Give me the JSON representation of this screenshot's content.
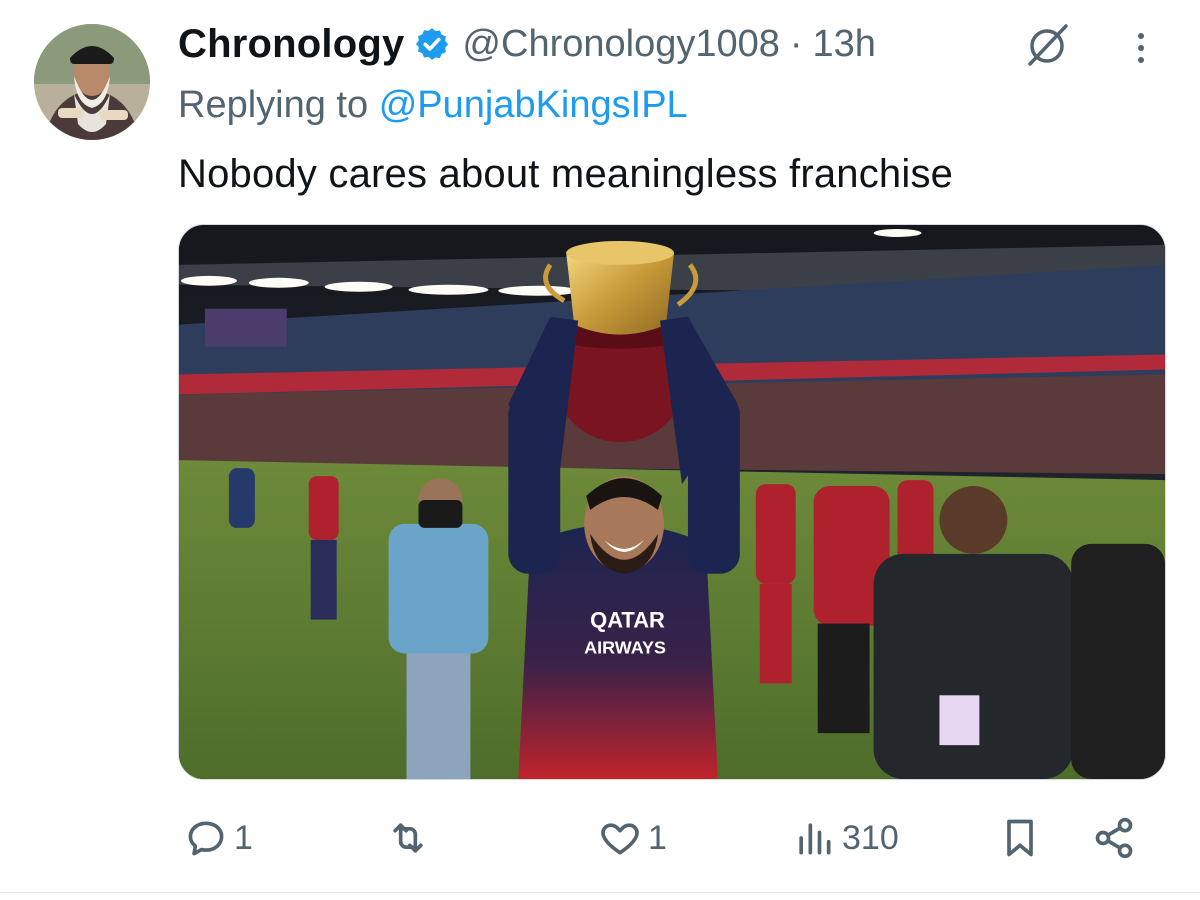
{
  "tweet": {
    "author": {
      "display_name": "Chronology",
      "handle": "@Chronology1008",
      "verified": true,
      "avatar_icon": "user-avatar"
    },
    "separator": "·",
    "time": "13h",
    "reply_prefix": "Replying to",
    "reply_to": "@PunjabKingsIPL",
    "text": "Nobody cares about meaningless franchise",
    "media": {
      "kind": "photo",
      "jersey_text_line1": "QATAR",
      "jersey_text_line2": "AIRWAYS"
    },
    "actions": {
      "reply_count": "1",
      "retweet_count": "",
      "like_count": "1",
      "views_count": "310"
    }
  },
  "colors": {
    "accent": "#1d9bf0",
    "secondary_text": "#536471",
    "primary_text": "#0f1419"
  }
}
